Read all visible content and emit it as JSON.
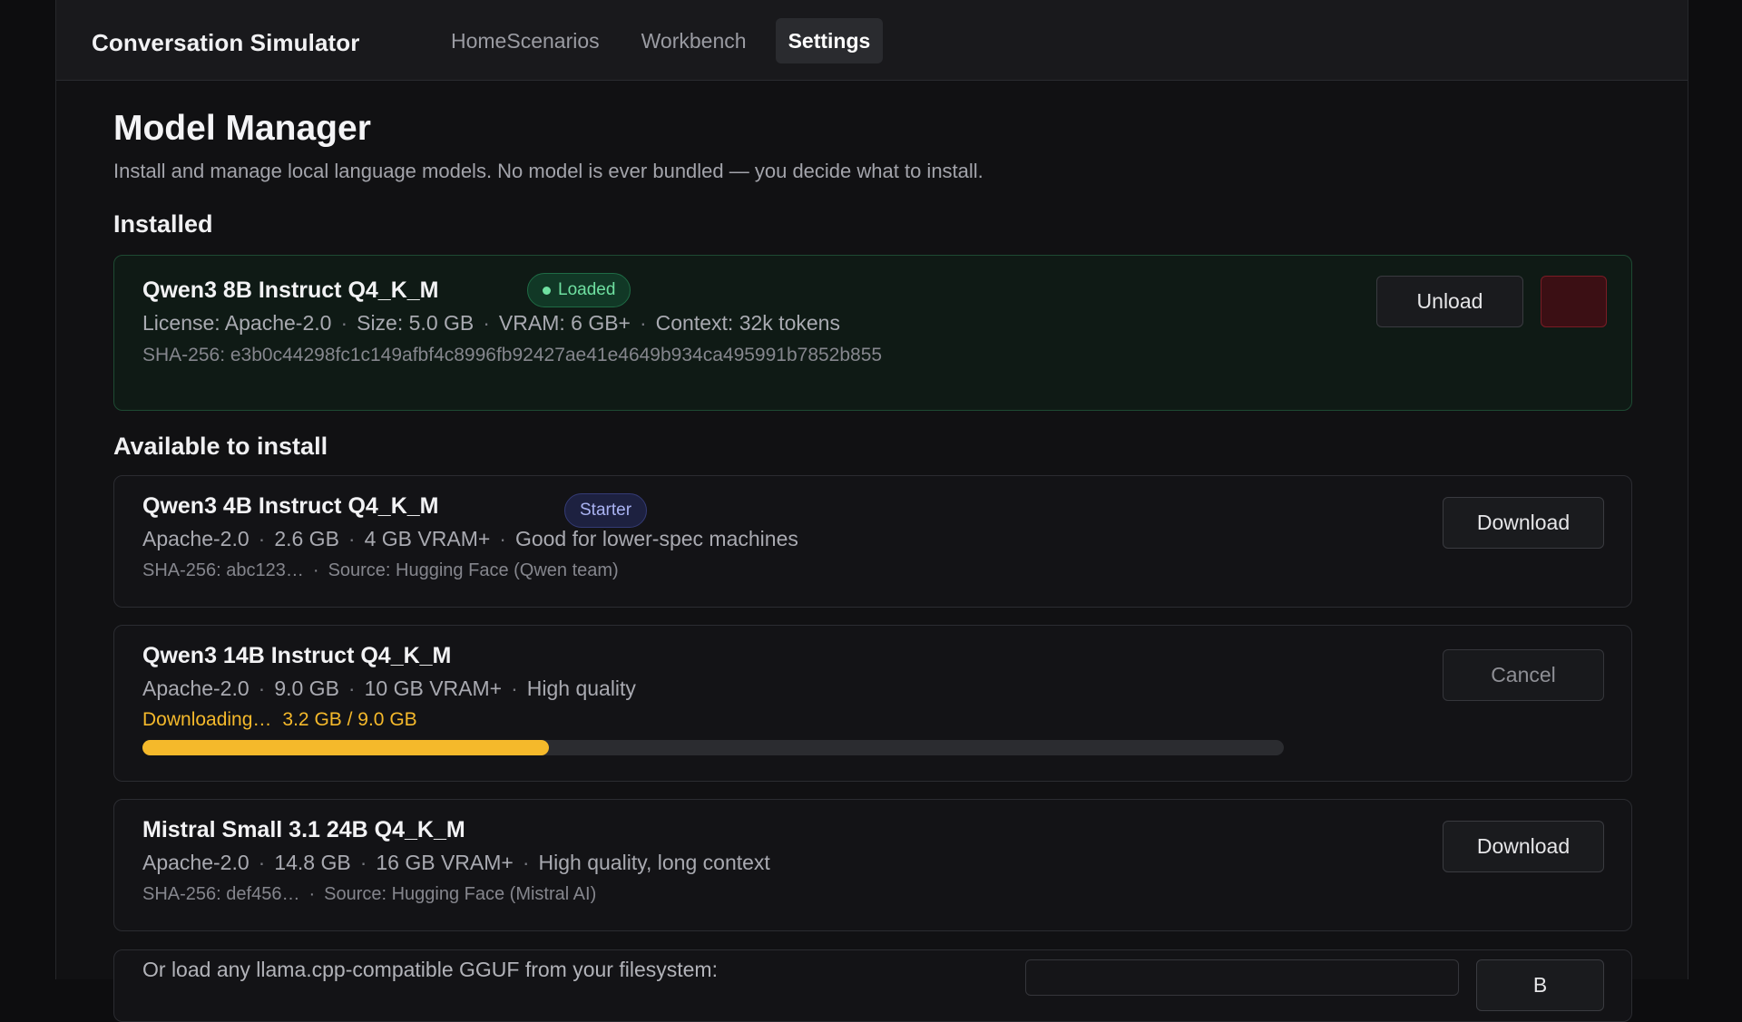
{
  "app": {
    "title": "Conversation Simulator"
  },
  "nav": {
    "home": "Home",
    "scenarios": "Scenarios",
    "workbench": "Workbench",
    "settings": "Settings",
    "active": "Settings"
  },
  "page": {
    "title": "Model Manager",
    "subtitle": "Install and manage local language models. No model is ever bundled — you decide what to install."
  },
  "installed": {
    "heading": "Installed",
    "model": {
      "name": "Qwen3 8B Instruct Q4_K_M",
      "badge": "Loaded",
      "license": "License: Apache-2.0",
      "size": "Size: 5.0 GB",
      "vram": "VRAM: 6 GB+",
      "context": "Context: 32k tokens",
      "sha": "SHA-256: e3b0c44298fc1c149afbf4c8996fb92427ae41e4649b934ca495991b7852b855",
      "unload_label": "Unload"
    }
  },
  "available": {
    "heading": "Available to install",
    "models": [
      {
        "name": "Qwen3 4B Instruct Q4_K_M",
        "badge": "Starter",
        "license": "Apache-2.0",
        "size": "2.6 GB",
        "vram": "4 GB VRAM+",
        "note": "Good for lower-spec machines",
        "sha": "SHA-256: abc123…",
        "source": "Source: Hugging Face (Qwen team)",
        "action": "Download"
      },
      {
        "name": "Qwen3 14B Instruct Q4_K_M",
        "license": "Apache-2.0",
        "size": "9.0 GB",
        "vram": "10 GB VRAM+",
        "note": "High quality",
        "status": "Downloading…",
        "progress_text": "3.2 GB / 9.0 GB",
        "progress_fraction": 0.356,
        "action": "Cancel"
      },
      {
        "name": "Mistral Small 3.1 24B Q4_K_M",
        "license": "Apache-2.0",
        "size": "14.8 GB",
        "vram": "16 GB VRAM+",
        "note": "High quality, long context",
        "sha": "SHA-256: def456…",
        "source": "Source: Hugging Face (Mistral AI)",
        "action": "Download"
      }
    ]
  },
  "gguf": {
    "text": "Or load any llama.cpp-compatible GGUF from your filesystem:",
    "button": "B"
  },
  "colors": {
    "accent_progress": "#f5b92b",
    "loaded_green": "#6fe0a1",
    "starter_indigo": "#aab3f2",
    "danger_red": "#7a1c25"
  }
}
